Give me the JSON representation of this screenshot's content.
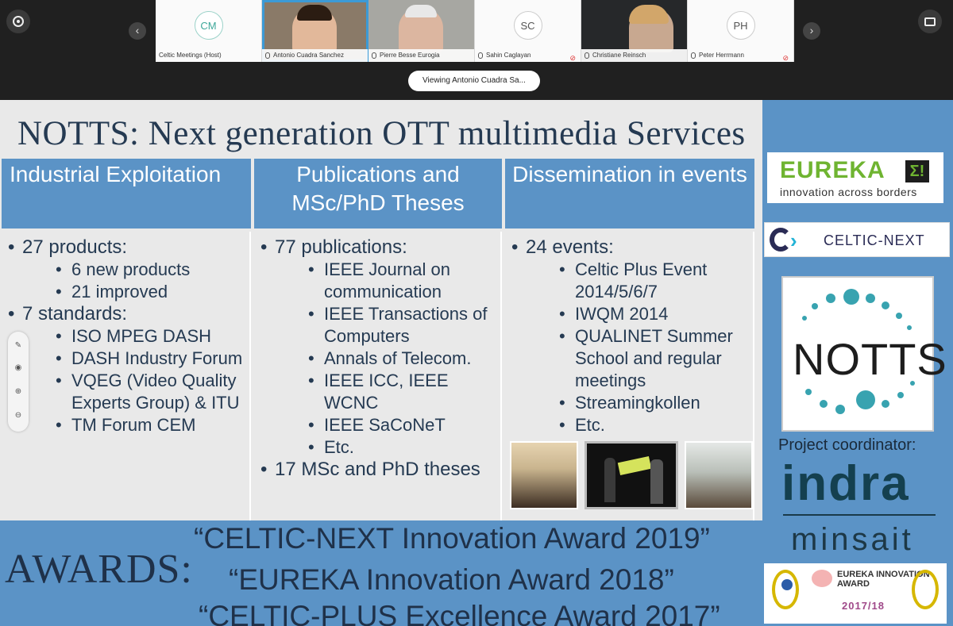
{
  "meeting": {
    "viewing_label": "Viewing Antonio Cuadra Sa...",
    "participants": [
      {
        "initials": "CM",
        "name": "Celtic Meetings (Host)",
        "video": false
      },
      {
        "initials": "",
        "name": "Antonio Cuadra Sanchez",
        "video": true,
        "active": true
      },
      {
        "initials": "",
        "name": "Pierre Besse Eurogia",
        "video": true
      },
      {
        "initials": "SC",
        "name": "Sahin Caglayan",
        "video": false,
        "muted": true
      },
      {
        "initials": "",
        "name": "Christiane Reinsch",
        "video": true
      },
      {
        "initials": "PH",
        "name": "Peter Herrmann",
        "video": false,
        "muted": true
      }
    ],
    "nav": {
      "prev": "‹",
      "next": "›"
    }
  },
  "slide": {
    "title": "NOTTS: Next generation OTT multimedia Services",
    "columns": [
      {
        "header": "Industrial Exploitation",
        "items": [
          {
            "text": "27 products:",
            "sub": [
              "6 new products",
              "21 improved"
            ]
          },
          {
            "text": "7 standards:",
            "sub": [
              "ISO MPEG DASH",
              "DASH Industry Forum",
              "VQEG (Video Quality Experts Group) & ITU",
              "TM Forum CEM"
            ]
          }
        ]
      },
      {
        "header": "Publications and MSc/PhD Theses",
        "items": [
          {
            "text": "77 publications:",
            "sub": [
              "IEEE Journal on communication",
              "IEEE Transactions of Computers",
              "Annals of Telecom.",
              "IEEE ICC, IEEE WCNC",
              "IEEE SaCoNeT",
              "Etc."
            ]
          },
          {
            "text": "17 MSc and PhD theses",
            "sub": []
          }
        ]
      },
      {
        "header": "Dissemination in events",
        "items": [
          {
            "text": "24 events:",
            "sub": [
              "Celtic Plus Event 2014/5/6/7",
              "IWQM 2014",
              "QUALINET Summer School and regular meetings",
              "Streamingkollen",
              "Etc."
            ]
          }
        ]
      }
    ],
    "logos": {
      "eureka_word": "EUREKA",
      "eureka_sigma": "Σ!",
      "eureka_tagline": "innovation across borders",
      "celtic_next": "CELTIC-NEXT",
      "notts": "NOTTS",
      "project_coordinator": "Project coordinator:",
      "indra": "indra",
      "minsait": "minsait",
      "award_title": "EUREKA INNOVATION AWARD",
      "award_year": "2017/18"
    },
    "awards_label": "AWARDS:",
    "awards": [
      "“CELTIC-NEXT Innovation Award 2019”",
      "“EUREKA Innovation Award 2018”",
      "“CELTIC-PLUS Excellence Award 2017”"
    ]
  },
  "icons": [
    "home-icon",
    "camera-icon",
    "pen-icon",
    "spotlight-icon",
    "zoom-in-icon",
    "zoom-out-icon"
  ],
  "colors": {
    "slide_blue": "#5b93c6",
    "title_navy": "#253a52",
    "eureka_green": "#6fb431",
    "notts_teal": "#38a3b0"
  }
}
